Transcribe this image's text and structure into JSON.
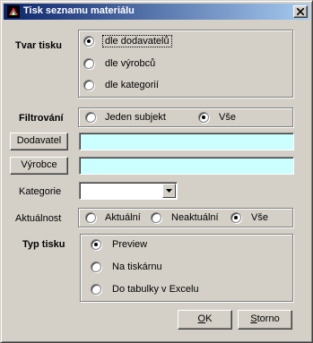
{
  "window": {
    "title": "Tisk seznamu materiálu",
    "close_icon": "close-icon"
  },
  "tvar_tisku": {
    "label": "Tvar tisku",
    "options": [
      {
        "label": "dle dodavatelů",
        "selected": true
      },
      {
        "label": "dle výrobců",
        "selected": false
      },
      {
        "label": "dle kategorií",
        "selected": false
      }
    ]
  },
  "filtrovani": {
    "label": "Filtrování",
    "options": [
      {
        "label": "Jeden subjekt",
        "selected": false
      },
      {
        "label": "Vše",
        "selected": true
      }
    ]
  },
  "dodavatel": {
    "button_label": "Dodavatel",
    "value": ""
  },
  "vyrobce": {
    "button_label": "Výrobce",
    "value": ""
  },
  "kategorie": {
    "label": "Kategorie",
    "value": ""
  },
  "aktualnost": {
    "label": "Aktuálnost",
    "options": [
      {
        "label": "Aktuální",
        "selected": false
      },
      {
        "label": "Neaktuální",
        "selected": false
      },
      {
        "label": "Vše",
        "selected": true
      }
    ]
  },
  "typ_tisku": {
    "label": "Typ tisku",
    "options": [
      {
        "label": "Preview",
        "selected": true
      },
      {
        "label": "Na tiskárnu",
        "selected": false
      },
      {
        "label": "Do tabulky v Excelu",
        "selected": false
      }
    ]
  },
  "buttons": {
    "ok_underlined": "O",
    "ok_rest": "K",
    "storno_underlined": "S",
    "storno_rest": "torno"
  },
  "colors": {
    "titlebar_start": "#0a246a",
    "titlebar_end": "#a6caf0",
    "field_bg": "#ccffff",
    "dialog_bg": "#d4d0c8"
  }
}
